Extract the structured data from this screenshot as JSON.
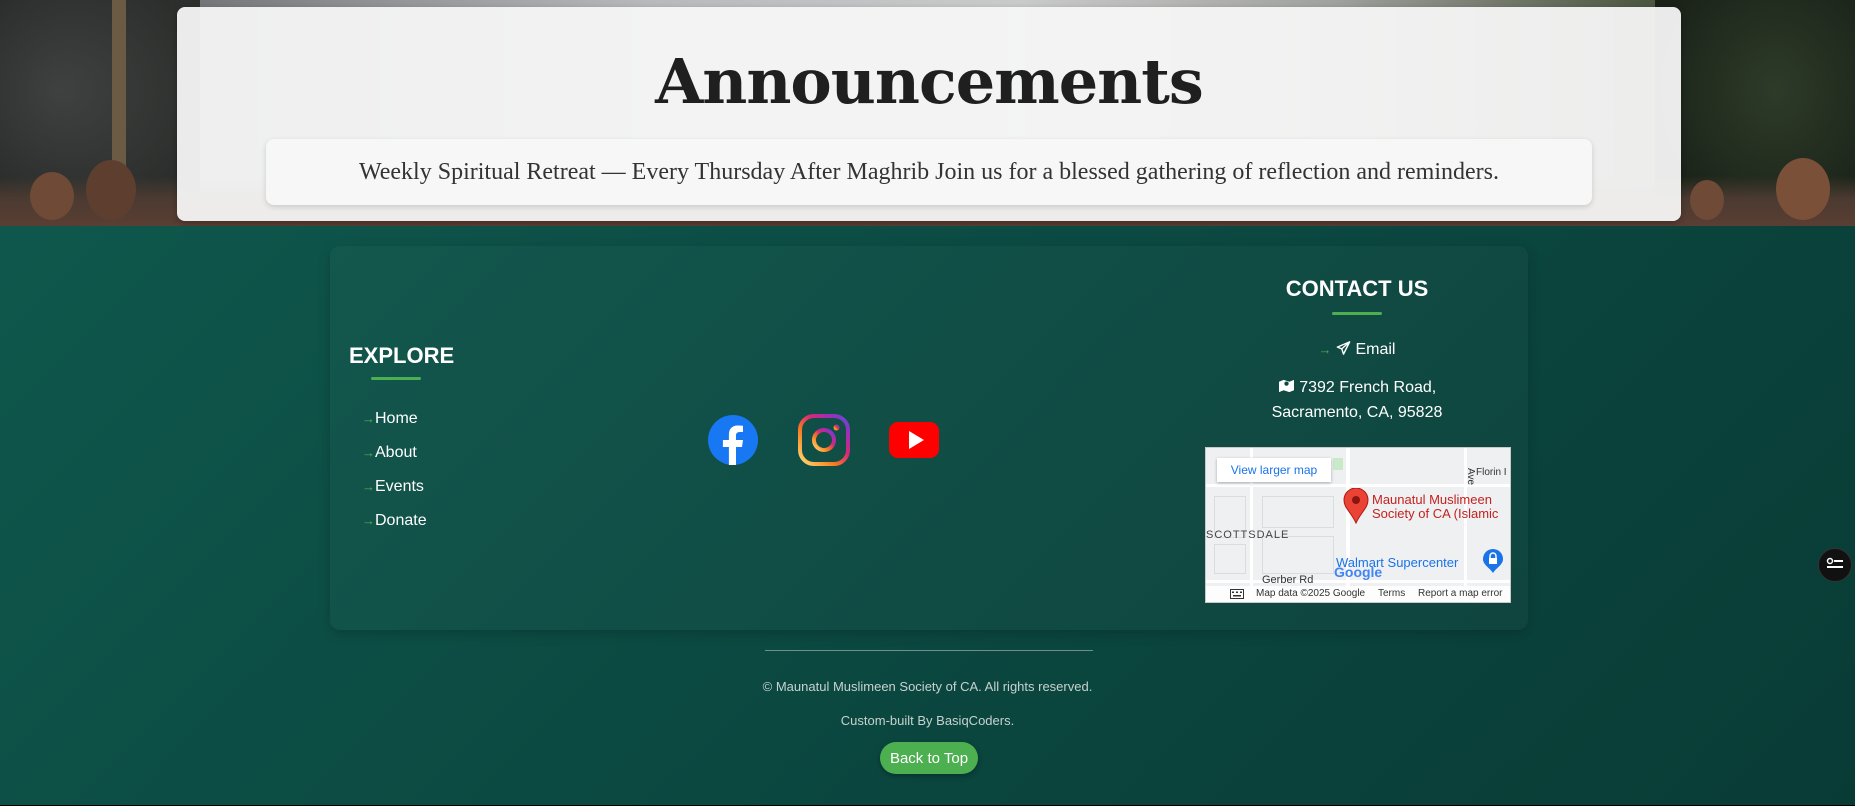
{
  "announcements": {
    "title": "Announcements",
    "items": [
      "Weekly Spiritual Retreat — Every Thursday After Maghrib Join us for a blessed gathering of reflection and reminders."
    ]
  },
  "explore": {
    "heading": "EXPLORE",
    "links": [
      {
        "arrow": "→",
        "label": "Home"
      },
      {
        "arrow": "→",
        "label": "About"
      },
      {
        "arrow": "→",
        "label": "Events"
      },
      {
        "arrow": "→",
        "label": "Donate"
      }
    ]
  },
  "social": [
    {
      "name": "facebook-icon",
      "color": "#1877f2"
    },
    {
      "name": "instagram-icon",
      "color": "#e1306c"
    },
    {
      "name": "youtube-icon",
      "color": "#ff0000"
    }
  ],
  "contact": {
    "heading": "CONTACT US",
    "email_arrow": "→",
    "email_label": "Email",
    "address_line1": "7392 French Road,",
    "address_line2": "Sacramento, CA, 95828"
  },
  "map": {
    "view_larger": "View larger map",
    "place_line1": "Maunatul Muslimeen",
    "place_line2": "Society of CA (Islamic",
    "label_florin": "Florin I",
    "label_scottsdale": "SCOTTSDALE",
    "label_walmart": "Walmart Supercenter",
    "label_gerber": "Gerber Rd",
    "label_ave": "Ave",
    "google": "Google",
    "map_data": "Map data ©2025 Google",
    "terms": "Terms",
    "report": "Report a map error"
  },
  "footer": {
    "copyright": "© Maunatul Muslimeen Society of CA. All rights reserved.",
    "credit": "Custom-built By BasiqCoders.",
    "back_to_top": "Back to Top"
  },
  "colors": {
    "accent": "#4caf50",
    "footer_bg": "#0b4a42"
  }
}
